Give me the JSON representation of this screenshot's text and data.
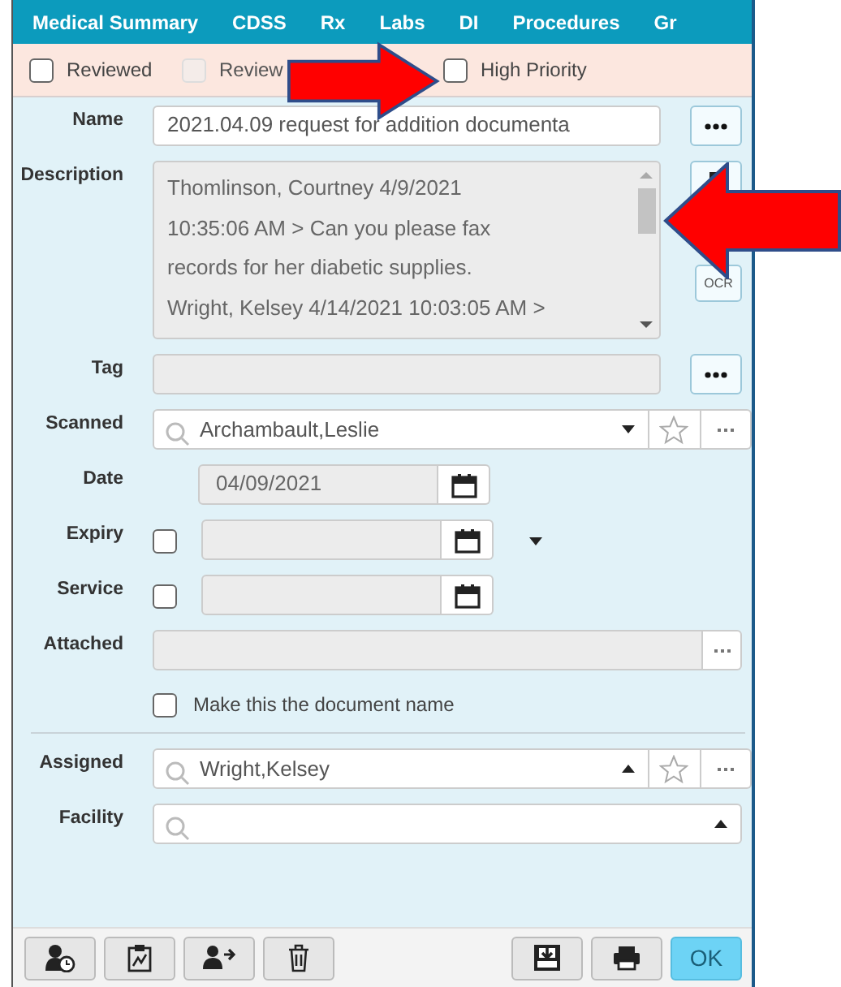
{
  "tabs": [
    {
      "label": "Medical Summary"
    },
    {
      "label": "CDSS"
    },
    {
      "label": "Rx"
    },
    {
      "label": "Labs"
    },
    {
      "label": "DI"
    },
    {
      "label": "Procedures"
    },
    {
      "label": "Gr"
    }
  ],
  "flags": [
    {
      "label": "Reviewed",
      "checked": false,
      "disabled": false
    },
    {
      "label": "Review",
      "checked": false,
      "disabled": true
    },
    {
      "label": "High Priority",
      "checked": false,
      "disabled": false
    }
  ],
  "form": {
    "name": {
      "label": "Name",
      "value": "2021.04.09 request for addition documenta"
    },
    "description": {
      "label": "Description",
      "lines": [
        "Thomlinson, Courtney 4/9/2021",
        "10:35:06 AM > Can you please fax",
        "records for her diabetic supplies.",
        "Wright, Kelsey 4/14/2021 10:03:05 AM >"
      ]
    },
    "tag": {
      "label": "Tag"
    },
    "scanned": {
      "label": "Scanned",
      "value": "Archambault,Leslie",
      "expanded": false
    },
    "date": {
      "label": "Date",
      "value": "04/09/2021"
    },
    "expiry": {
      "label": "Expiry",
      "checked": false
    },
    "service": {
      "label": "Service",
      "checked": false
    },
    "attached": {
      "label": "Attached"
    },
    "make_name": {
      "label": "Make this the document name",
      "checked": false
    },
    "assigned": {
      "label": "Assigned",
      "value": "Wright,Kelsey",
      "expanded": true
    },
    "facility": {
      "label": "Facility",
      "expanded": true
    }
  },
  "ocr_button": "OCR",
  "ok_button": "OK"
}
